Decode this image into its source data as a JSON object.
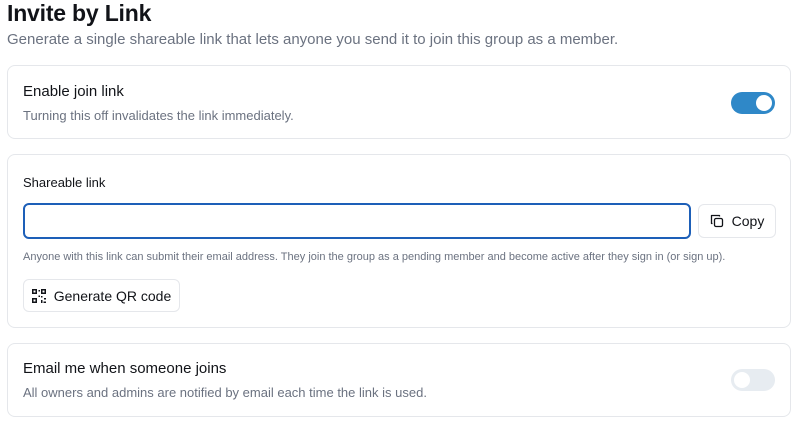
{
  "header": {
    "title": "Invite by Link",
    "subtitle": "Generate a single shareable link that lets anyone you send it to join this group as a member."
  },
  "join_link": {
    "title": "Enable join link",
    "description": "Turning this off invalidates the link immediately.",
    "enabled": true,
    "accent_color": "#2f88c8"
  },
  "shareable_link": {
    "label": "Shareable link",
    "value": "",
    "placeholder": "",
    "copy_label": "Copy",
    "copy_icon": "copy-icon",
    "help_text": "Anyone with this link can submit their email address. They join the group as a pending member and become active after they sign in (or sign up).",
    "qr_label": "Generate QR code",
    "qr_icon": "qr-code-icon"
  },
  "email_notify": {
    "title": "Email me when someone joins",
    "description": "All owners and admins are notified by email each time the link is used.",
    "enabled": false
  }
}
